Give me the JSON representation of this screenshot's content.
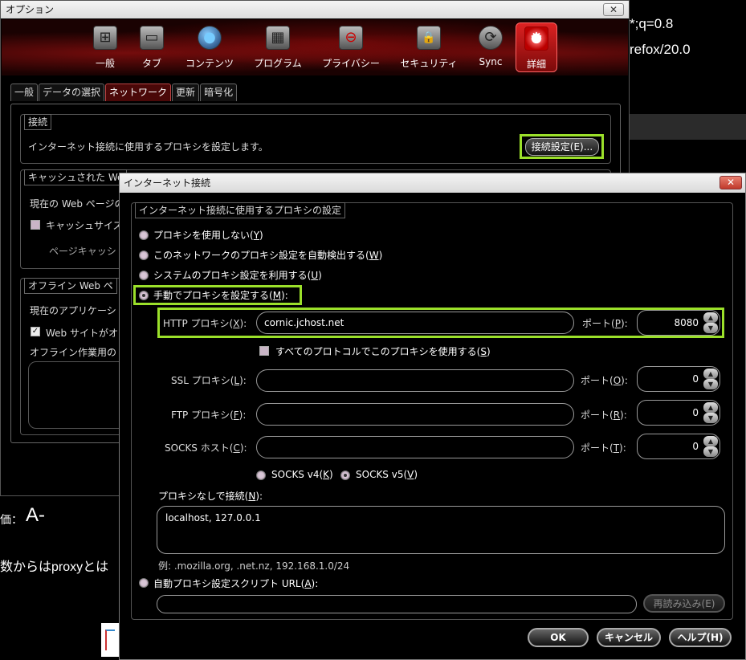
{
  "background_page": {
    "line1": "*;q=0.8",
    "line2": "refox/20.0",
    "grade_label": "価：",
    "grade_value": "A-",
    "body_text": "数からはproxyとは"
  },
  "options_window": {
    "title": "オプション",
    "close": "✕",
    "toolbar": [
      {
        "label": "一般",
        "icon": "switch-icon",
        "glyph": "⊞"
      },
      {
        "label": "タブ",
        "icon": "tab-icon",
        "glyph": "▭"
      },
      {
        "label": "コンテンツ",
        "icon": "globe-icon",
        "glyph": "●"
      },
      {
        "label": "プログラム",
        "icon": "program-icon",
        "glyph": "▦"
      },
      {
        "label": "プライバシー",
        "icon": "privacy-icon",
        "glyph": "⊖"
      },
      {
        "label": "セキュリティ",
        "icon": "lock-icon",
        "glyph": "🔒"
      },
      {
        "label": "Sync",
        "icon": "sync-icon",
        "glyph": "⟳"
      },
      {
        "label": "詳細",
        "icon": "gear-icon",
        "glyph": "⚙"
      }
    ],
    "subtabs": [
      "一般",
      "データの選択",
      "ネットワーク",
      "更新",
      "暗号化"
    ],
    "connection": {
      "legend": "接続",
      "description": "インターネット接続に使用するプロキシを設定します。",
      "button": "接続設定(E)..."
    },
    "cache": {
      "legend": "キャッシュされた We",
      "line1": "現在の Web ページの",
      "checkbox": "キャッシュサイズ",
      "line3": "ページキャッシ"
    },
    "offline": {
      "legend": "オフライン Web ペ",
      "line1": "現在のアプリケーシ",
      "checkbox": "Web サイトがオ",
      "line3": "オフライン作業用の"
    }
  },
  "connection_dialog": {
    "title": "インターネット接続",
    "close": "✕",
    "group_legend": "インターネット接続に使用するプロキシの設定",
    "options": {
      "no_proxy": {
        "text": "プロキシを使用しない(",
        "key": "Y",
        "tail": ")"
      },
      "auto_detect": {
        "text": "このネットワークのプロキシ設定を自動検出する(",
        "key": "W",
        "tail": ")"
      },
      "system": {
        "text": "システムのプロキシ設定を利用する(",
        "key": "U",
        "tail": ")"
      },
      "manual": {
        "text": "手動でプロキシを設定する(",
        "key": "M",
        "tail": "):"
      },
      "auto_url": {
        "text": "自動プロキシ設定スクリプト URL(",
        "key": "A",
        "tail": "):"
      }
    },
    "http": {
      "label_pre": "HTTP プロキシ(",
      "key": "X",
      "label_post": "):",
      "value": "cornic.jchost.net",
      "port_pre": "ポート(",
      "port_key": "P",
      "port_post": "):",
      "port": "8080"
    },
    "use_all": {
      "text": "すべてのプロトコルでこのプロキシを使用する(",
      "key": "S",
      "tail": ")"
    },
    "ssl": {
      "label_pre": "SSL プロキシ(",
      "key": "L",
      "label_post": "):",
      "value": "",
      "port_pre": "ポート(",
      "port_key": "O",
      "port_post": "):",
      "port": "0"
    },
    "ftp": {
      "label_pre": "FTP プロキシ(",
      "key": "F",
      "label_post": "):",
      "value": "",
      "port_pre": "ポート(",
      "port_key": "R",
      "port_post": "):",
      "port": "0"
    },
    "socks": {
      "label_pre": "SOCKS ホスト(",
      "key": "C",
      "label_post": "):",
      "value": "",
      "port_pre": "ポート(",
      "port_key": "T",
      "port_post": "):",
      "port": "0"
    },
    "socks_v4": {
      "text": "SOCKS v4(",
      "key": "K",
      "tail": ")"
    },
    "socks_v5": {
      "text": "SOCKS v5(",
      "key": "V",
      "tail": ")"
    },
    "no_proxy_for": {
      "text": "プロキシなしで接続(",
      "key": "N",
      "tail": "):"
    },
    "no_proxy_value": "localhost, 127.0.0.1",
    "example": "例: .mozilla.org, .net.nz, 192.168.1.0/24",
    "auto_url_value": "",
    "reload": "再読み込み(E)",
    "ok": "OK",
    "cancel": "キャンセル",
    "help": "ヘルプ(H)"
  },
  "colors": {
    "highlight": "#9be02a",
    "active_tab": "#4a0808",
    "toolbar_red": "#cc2222"
  }
}
